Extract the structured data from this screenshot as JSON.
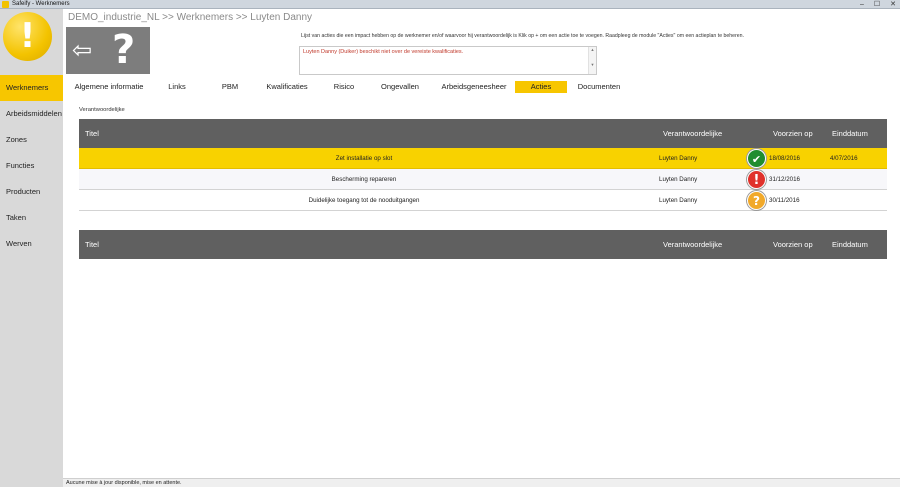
{
  "window": {
    "title": "Safeify - Werknemers",
    "controls": [
      "–",
      "☐",
      "✕"
    ]
  },
  "sidebar": {
    "items": [
      {
        "label": "Werknemers",
        "active": true
      },
      {
        "label": "Arbeidsmiddelen",
        "active": false
      },
      {
        "label": "Zones",
        "active": false
      },
      {
        "label": "Functies",
        "active": false
      },
      {
        "label": "Producten",
        "active": false
      },
      {
        "label": "Taken",
        "active": false
      },
      {
        "label": "Werven",
        "active": false
      }
    ]
  },
  "breadcrumb": "DEMO_industrie_NL >> Werknemers >> Luyten Danny",
  "photo": {
    "icons": [
      "back-arrow-icon",
      "question-mark-icon"
    ],
    "arrow_glyph": "⇦",
    "qmark_glyph": "?"
  },
  "info_text": "Lijst van acties die een impact hebben op de werknemer en/of waarvoor hij verantwoordelijk is Klik op + om een actie toe te voegen. Raadpleeg de module \"Acties\" om een actieplan te beheren.",
  "message": "Luyten Danny (Duiker) beschikt niet over de vereiste kwalificaties.",
  "tabs": [
    {
      "label": "Algemene informatie",
      "active": false
    },
    {
      "label": "Links",
      "active": false
    },
    {
      "label": "PBM",
      "active": false
    },
    {
      "label": "Kwalificaties",
      "active": false
    },
    {
      "label": "Risico",
      "active": false
    },
    {
      "label": "Ongevallen",
      "active": false
    },
    {
      "label": "Arbeidsgeneesheer",
      "active": false
    },
    {
      "label": "Acties",
      "active": true
    },
    {
      "label": "Documenten",
      "active": false
    }
  ],
  "section_label": "Verantwoordelijke",
  "table1": {
    "headers": {
      "title": "Titel",
      "responsible": "Verantwoordelijke",
      "due": "Voorzien op",
      "end": "Einddatum"
    },
    "rows": [
      {
        "title": "Zet installatie op slot",
        "responsible": "Luyten Danny",
        "status": "ok",
        "status_glyph": "✔",
        "due": "18/08/2016",
        "end": "4/07/2016",
        "selected": true
      },
      {
        "title": "Bescherming repareren",
        "responsible": "Luyten Danny",
        "status": "alert",
        "status_glyph": "!",
        "due": "31/12/2016",
        "end": "",
        "selected": false
      },
      {
        "title": "Duidelijke toegang tot de nooduitgangen",
        "responsible": "Luyten Danny",
        "status": "question",
        "status_glyph": "?",
        "due": "30/11/2016",
        "end": "",
        "selected": false
      }
    ]
  },
  "table2": {
    "headers": {
      "title": "Titel",
      "responsible": "Verantwoordelijke",
      "due": "Voorzien op",
      "end": "Einddatum"
    },
    "rows": []
  },
  "status_bar": "Aucune mise à jour disponible, mise en attente.",
  "colors": {
    "accent": "#f7c600",
    "header": "#606060",
    "ok": "#1f8d2f",
    "alert": "#e0312b",
    "question": "#f1a92a",
    "message": "#c0392b"
  }
}
